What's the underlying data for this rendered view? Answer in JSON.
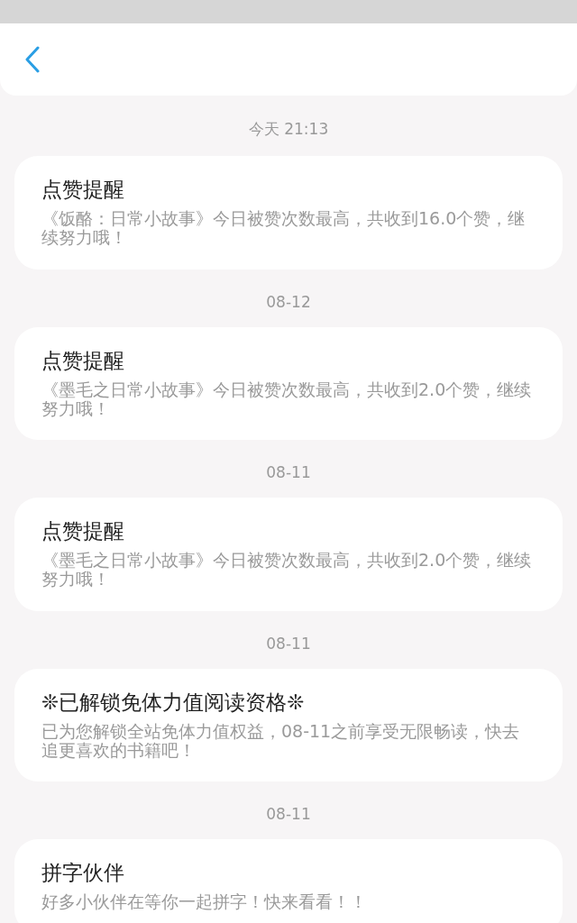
{
  "messages": [
    {
      "date": "今天 21:13",
      "title": "点赞提醒",
      "body": "《饭酪：日常小故事》今日被赞次数最高，共收到16.0个赞，继续努力哦！"
    },
    {
      "date": "08-12",
      "title": "点赞提醒",
      "body": "《墨毛之日常小故事》今日被赞次数最高，共收到2.0个赞，继续努力哦！"
    },
    {
      "date": "08-11",
      "title": "点赞提醒",
      "body": "《墨毛之日常小故事》今日被赞次数最高，共收到2.0个赞，继续努力哦！"
    },
    {
      "date": "08-11",
      "title": "❊已解锁免体力值阅读资格❊",
      "body": "已为您解锁全站免体力值权益，08-11之前享受无限畅读，快去追更喜欢的书籍吧！"
    },
    {
      "date": "08-11",
      "title": "拼字伙伴",
      "body": "好多小伙伴在等你一起拼字！快来看看！！"
    }
  ]
}
